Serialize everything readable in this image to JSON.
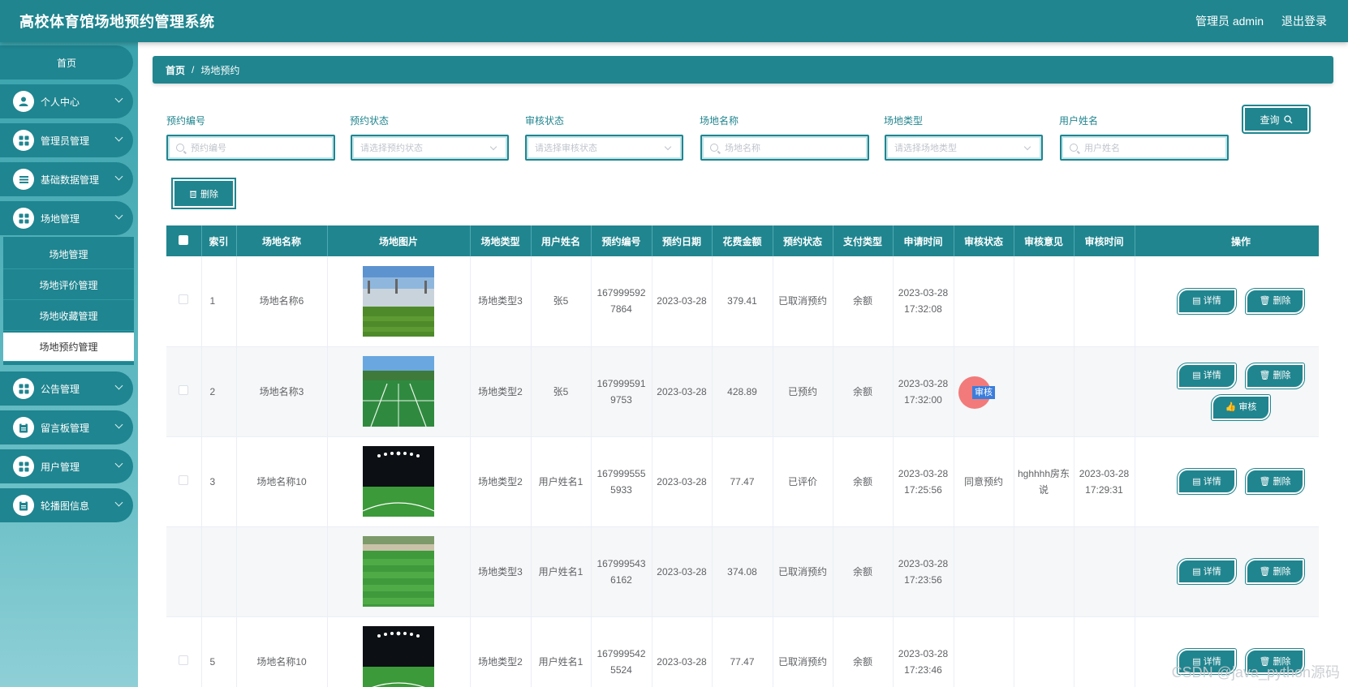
{
  "header": {
    "title": "高校体育馆场地预约管理系统",
    "user": "管理员 admin",
    "logout": "退出登录"
  },
  "sidebar": {
    "home": "首页",
    "items": [
      {
        "label": "个人中心",
        "icon": "user-icon"
      },
      {
        "label": "管理员管理",
        "icon": "grid-icon"
      },
      {
        "label": "基础数据管理",
        "icon": "list-icon"
      },
      {
        "label": "场地管理",
        "icon": "grid-icon"
      },
      {
        "label": "公告管理",
        "icon": "grid-icon"
      },
      {
        "label": "留言板管理",
        "icon": "clipboard-icon"
      },
      {
        "label": "用户管理",
        "icon": "grid-icon"
      },
      {
        "label": "轮播图信息",
        "icon": "clipboard-icon"
      }
    ],
    "sub_items": [
      "场地管理",
      "场地评价管理",
      "场地收藏管理",
      "场地预约管理"
    ]
  },
  "breadcrumb": {
    "home": "首页",
    "separator": "/",
    "current": "场地预约"
  },
  "search": {
    "fields": [
      {
        "label": "预约编号",
        "placeholder": "预约编号",
        "type": "input"
      },
      {
        "label": "预约状态",
        "placeholder": "请选择预约状态",
        "type": "select"
      },
      {
        "label": "审核状态",
        "placeholder": "请选择审核状态",
        "type": "select"
      },
      {
        "label": "场地名称",
        "placeholder": "场地名称",
        "type": "input"
      },
      {
        "label": "场地类型",
        "placeholder": "请选择场地类型",
        "type": "select"
      },
      {
        "label": "用户姓名",
        "placeholder": "用户姓名",
        "type": "input"
      }
    ],
    "query_label": "查询"
  },
  "toolbar": {
    "delete_label": "删除"
  },
  "table": {
    "headers": [
      "索引",
      "场地名称",
      "场地图片",
      "场地类型",
      "用户姓名",
      "预约编号",
      "预约日期",
      "花费金额",
      "预约状态",
      "支付类型",
      "申请时间",
      "审核状态",
      "审核意见",
      "审核时间",
      "操作"
    ],
    "rows": [
      {
        "index": "1",
        "name": "场地名称6",
        "type": "场地类型3",
        "user": "张5",
        "no": "1679995927864",
        "date": "2023-03-28",
        "amount": "379.41",
        "status": "已取消预约",
        "pay": "余额",
        "apply": "2023-03-28 17:32:08",
        "audit": "",
        "opinion": "",
        "audit_time": "",
        "photo": "stadium-seats"
      },
      {
        "index": "2",
        "name": "场地名称3",
        "type": "场地类型2",
        "user": "张5",
        "no": "1679995919753",
        "date": "2023-03-28",
        "amount": "428.89",
        "status": "已预约",
        "pay": "余额",
        "apply": "2023-03-28 17:32:00",
        "audit": "",
        "opinion": "",
        "audit_time": "",
        "photo": "tennis-court"
      },
      {
        "index": "3",
        "name": "场地名称10",
        "type": "场地类型2",
        "user": "用户姓名1",
        "no": "1679995555933",
        "date": "2023-03-28",
        "amount": "77.47",
        "status": "已评价",
        "pay": "余额",
        "apply": "2023-03-28 17:25:56",
        "audit": "同意预约",
        "opinion": "hghhhh房东说",
        "audit_time": "2023-03-28 17:29:31",
        "photo": "night-field"
      },
      {
        "index": "",
        "name": "",
        "type": "场地类型3",
        "user": "用户姓名1",
        "no": "1679995436162",
        "date": "2023-03-28",
        "amount": "374.08",
        "status": "已取消预约",
        "pay": "余额",
        "apply": "2023-03-28 17:23:56",
        "audit": "",
        "opinion": "",
        "audit_time": "",
        "photo": "green-field"
      },
      {
        "index": "5",
        "name": "场地名称10",
        "type": "场地类型2",
        "user": "用户姓名1",
        "no": "1679995425524",
        "date": "2023-03-28",
        "amount": "77.47",
        "status": "已取消预约",
        "pay": "余额",
        "apply": "2023-03-28 17:23:46",
        "audit": "",
        "opinion": "",
        "audit_time": "",
        "photo": "night-field"
      }
    ],
    "ops": {
      "detail": "详情",
      "delete": "删除",
      "audit": "审核"
    },
    "audit_highlight": "审核"
  },
  "watermark": "CSDN @java_python源码",
  "colors": {
    "primary": "#20858f",
    "accent": "#3b7ddd"
  }
}
